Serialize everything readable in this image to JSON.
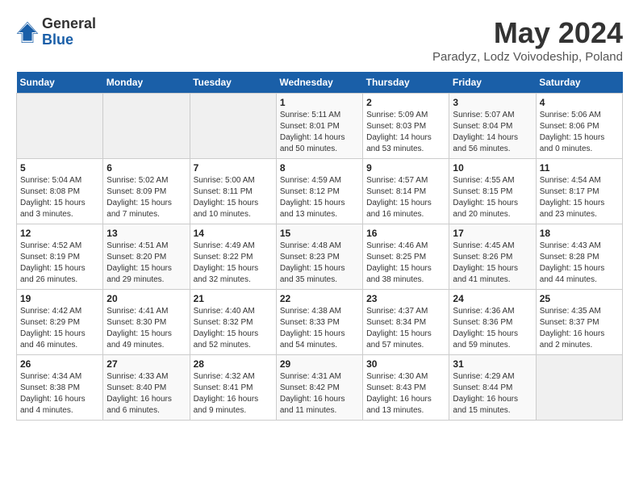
{
  "header": {
    "logo": {
      "general": "General",
      "blue": "Blue"
    },
    "title": "May 2024",
    "subtitle": "Paradyz, Lodz Voivodeship, Poland"
  },
  "calendar": {
    "days_of_week": [
      "Sunday",
      "Monday",
      "Tuesday",
      "Wednesday",
      "Thursday",
      "Friday",
      "Saturday"
    ],
    "weeks": [
      [
        {
          "day": "",
          "info": ""
        },
        {
          "day": "",
          "info": ""
        },
        {
          "day": "",
          "info": ""
        },
        {
          "day": "1",
          "info": "Sunrise: 5:11 AM\nSunset: 8:01 PM\nDaylight: 14 hours\nand 50 minutes."
        },
        {
          "day": "2",
          "info": "Sunrise: 5:09 AM\nSunset: 8:03 PM\nDaylight: 14 hours\nand 53 minutes."
        },
        {
          "day": "3",
          "info": "Sunrise: 5:07 AM\nSunset: 8:04 PM\nDaylight: 14 hours\nand 56 minutes."
        },
        {
          "day": "4",
          "info": "Sunrise: 5:06 AM\nSunset: 8:06 PM\nDaylight: 15 hours\nand 0 minutes."
        }
      ],
      [
        {
          "day": "5",
          "info": "Sunrise: 5:04 AM\nSunset: 8:08 PM\nDaylight: 15 hours\nand 3 minutes."
        },
        {
          "day": "6",
          "info": "Sunrise: 5:02 AM\nSunset: 8:09 PM\nDaylight: 15 hours\nand 7 minutes."
        },
        {
          "day": "7",
          "info": "Sunrise: 5:00 AM\nSunset: 8:11 PM\nDaylight: 15 hours\nand 10 minutes."
        },
        {
          "day": "8",
          "info": "Sunrise: 4:59 AM\nSunset: 8:12 PM\nDaylight: 15 hours\nand 13 minutes."
        },
        {
          "day": "9",
          "info": "Sunrise: 4:57 AM\nSunset: 8:14 PM\nDaylight: 15 hours\nand 16 minutes."
        },
        {
          "day": "10",
          "info": "Sunrise: 4:55 AM\nSunset: 8:15 PM\nDaylight: 15 hours\nand 20 minutes."
        },
        {
          "day": "11",
          "info": "Sunrise: 4:54 AM\nSunset: 8:17 PM\nDaylight: 15 hours\nand 23 minutes."
        }
      ],
      [
        {
          "day": "12",
          "info": "Sunrise: 4:52 AM\nSunset: 8:19 PM\nDaylight: 15 hours\nand 26 minutes."
        },
        {
          "day": "13",
          "info": "Sunrise: 4:51 AM\nSunset: 8:20 PM\nDaylight: 15 hours\nand 29 minutes."
        },
        {
          "day": "14",
          "info": "Sunrise: 4:49 AM\nSunset: 8:22 PM\nDaylight: 15 hours\nand 32 minutes."
        },
        {
          "day": "15",
          "info": "Sunrise: 4:48 AM\nSunset: 8:23 PM\nDaylight: 15 hours\nand 35 minutes."
        },
        {
          "day": "16",
          "info": "Sunrise: 4:46 AM\nSunset: 8:25 PM\nDaylight: 15 hours\nand 38 minutes."
        },
        {
          "day": "17",
          "info": "Sunrise: 4:45 AM\nSunset: 8:26 PM\nDaylight: 15 hours\nand 41 minutes."
        },
        {
          "day": "18",
          "info": "Sunrise: 4:43 AM\nSunset: 8:28 PM\nDaylight: 15 hours\nand 44 minutes."
        }
      ],
      [
        {
          "day": "19",
          "info": "Sunrise: 4:42 AM\nSunset: 8:29 PM\nDaylight: 15 hours\nand 46 minutes."
        },
        {
          "day": "20",
          "info": "Sunrise: 4:41 AM\nSunset: 8:30 PM\nDaylight: 15 hours\nand 49 minutes."
        },
        {
          "day": "21",
          "info": "Sunrise: 4:40 AM\nSunset: 8:32 PM\nDaylight: 15 hours\nand 52 minutes."
        },
        {
          "day": "22",
          "info": "Sunrise: 4:38 AM\nSunset: 8:33 PM\nDaylight: 15 hours\nand 54 minutes."
        },
        {
          "day": "23",
          "info": "Sunrise: 4:37 AM\nSunset: 8:34 PM\nDaylight: 15 hours\nand 57 minutes."
        },
        {
          "day": "24",
          "info": "Sunrise: 4:36 AM\nSunset: 8:36 PM\nDaylight: 15 hours\nand 59 minutes."
        },
        {
          "day": "25",
          "info": "Sunrise: 4:35 AM\nSunset: 8:37 PM\nDaylight: 16 hours\nand 2 minutes."
        }
      ],
      [
        {
          "day": "26",
          "info": "Sunrise: 4:34 AM\nSunset: 8:38 PM\nDaylight: 16 hours\nand 4 minutes."
        },
        {
          "day": "27",
          "info": "Sunrise: 4:33 AM\nSunset: 8:40 PM\nDaylight: 16 hours\nand 6 minutes."
        },
        {
          "day": "28",
          "info": "Sunrise: 4:32 AM\nSunset: 8:41 PM\nDaylight: 16 hours\nand 9 minutes."
        },
        {
          "day": "29",
          "info": "Sunrise: 4:31 AM\nSunset: 8:42 PM\nDaylight: 16 hours\nand 11 minutes."
        },
        {
          "day": "30",
          "info": "Sunrise: 4:30 AM\nSunset: 8:43 PM\nDaylight: 16 hours\nand 13 minutes."
        },
        {
          "day": "31",
          "info": "Sunrise: 4:29 AM\nSunset: 8:44 PM\nDaylight: 16 hours\nand 15 minutes."
        },
        {
          "day": "",
          "info": ""
        }
      ]
    ]
  }
}
